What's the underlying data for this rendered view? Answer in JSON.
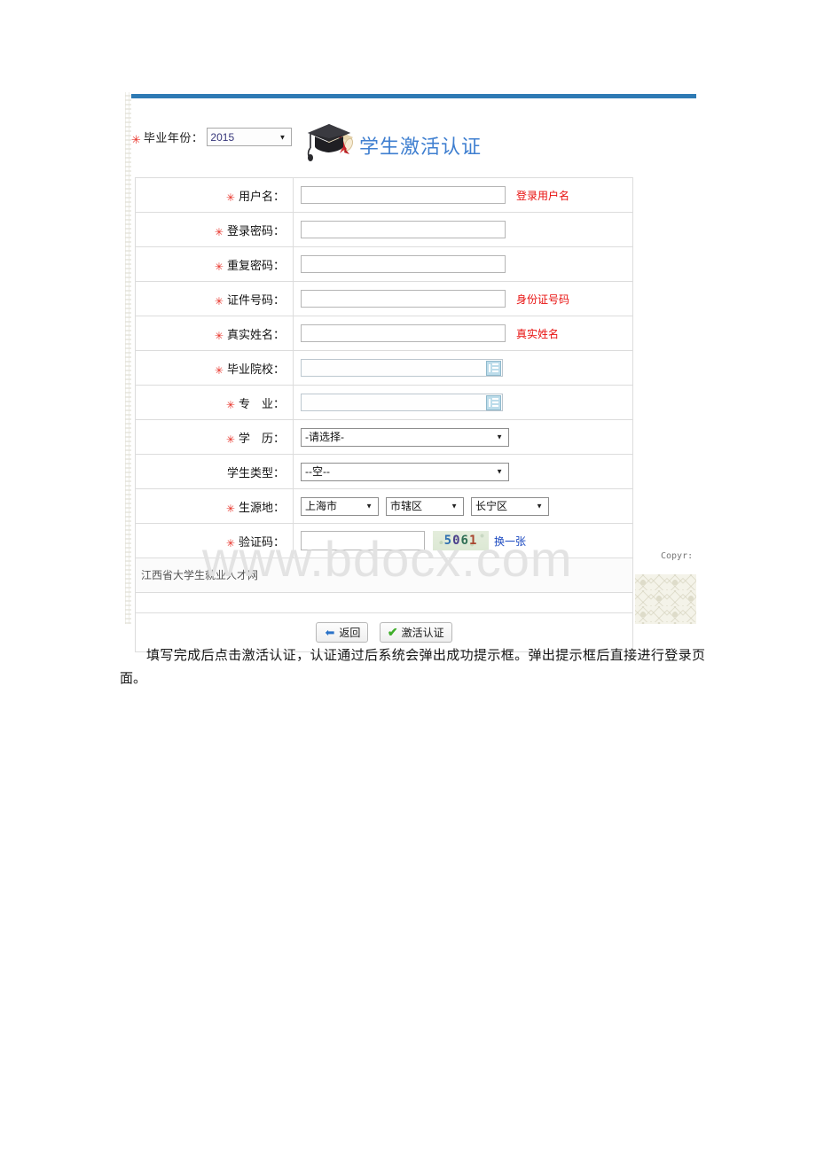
{
  "document": {
    "watermark": "www.bdocx.com"
  },
  "header": {
    "year_label": "毕业年份：",
    "year_value": "2015",
    "year_options": [
      "2015"
    ],
    "logo_title": "学生激活认证",
    "logo_icon": "graduation-cap-diploma-icon",
    "accent_color": "#2e7ab4",
    "title_color": "#3f7fd0"
  },
  "form": {
    "rows": [
      {
        "label": "用户名：",
        "required": true,
        "type": "text",
        "value": "",
        "hint": "登录用户名"
      },
      {
        "label": "登录密码：",
        "required": true,
        "type": "password",
        "value": "",
        "hint": ""
      },
      {
        "label": "重复密码：",
        "required": true,
        "type": "password",
        "value": "",
        "hint": ""
      },
      {
        "label": "证件号码：",
        "required": true,
        "type": "text",
        "value": "",
        "hint": "身份证号码"
      },
      {
        "label": "真实姓名：",
        "required": true,
        "type": "text",
        "value": "",
        "hint": "真实姓名"
      },
      {
        "label": "毕业院校：",
        "required": true,
        "type": "picker",
        "value": "",
        "hint": "",
        "picker_icon": "list-picker-icon"
      },
      {
        "label": "专　业：",
        "required": true,
        "type": "picker",
        "value": "",
        "hint": "",
        "picker_icon": "list-picker-icon"
      },
      {
        "label": "学　历：",
        "required": true,
        "type": "select",
        "value": "-请选择-",
        "options": [
          "-请选择-"
        ],
        "hint": ""
      },
      {
        "label": "学生类型：",
        "required": false,
        "type": "select",
        "value": "--空--",
        "options": [
          "--空--"
        ],
        "hint": ""
      },
      {
        "label": "生源地：",
        "required": true,
        "type": "cascade",
        "selects": [
          {
            "value": "上海市",
            "options": [
              "上海市"
            ]
          },
          {
            "value": "市辖区",
            "options": [
              "市辖区"
            ]
          },
          {
            "value": "长宁区",
            "options": [
              "长宁区"
            ]
          }
        ],
        "hint": ""
      },
      {
        "label": "验证码：",
        "required": true,
        "type": "captcha",
        "value": "",
        "captcha_text": "5061",
        "refresh_label": "换一张",
        "hint": ""
      }
    ]
  },
  "footer": {
    "site_name": "江西省大学生就业人才网",
    "copyright_fragment": "Copyr:",
    "back_button": "返回",
    "back_icon": "arrow-left-icon",
    "submit_button": "激活认证",
    "submit_icon": "check-icon"
  },
  "body_text": {
    "line1": "填写完成后点击激活认证，认证通过后系统会弹出成功提示框。弹出提示框后直",
    "line2": "接进行登录页面。"
  }
}
